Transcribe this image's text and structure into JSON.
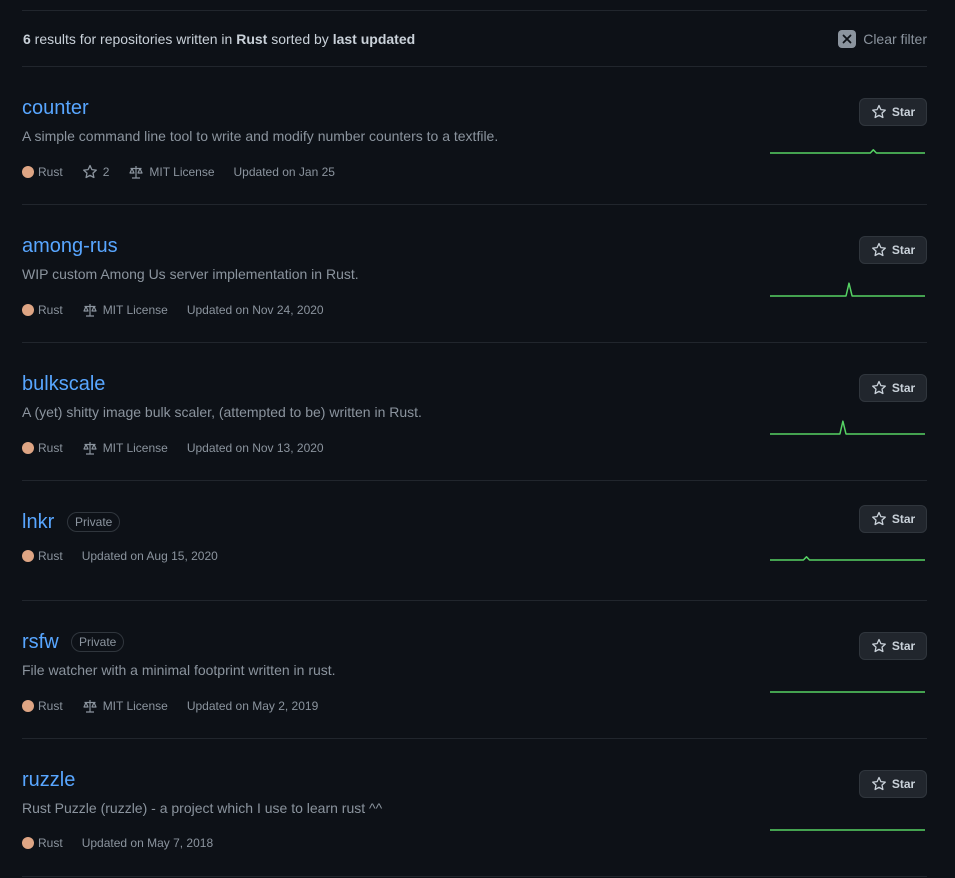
{
  "header": {
    "count": "6",
    "text_a": " results for repositories written in ",
    "language": "Rust",
    "text_b": " sorted by ",
    "sort": "last updated",
    "clear_label": "Clear filter"
  },
  "star_label": "Star",
  "colors": {
    "rust": "#dea584",
    "link": "#58a6ff",
    "spark": "#56d364"
  },
  "repos": [
    {
      "name": "counter",
      "description": "A simple command line tool to write and modify number counters to a textfile.",
      "language": "Rust",
      "stars": "2",
      "license": "MIT License",
      "updated": "Updated on Jan 25",
      "activity": [
        0,
        0,
        0,
        0,
        0,
        0,
        0,
        0,
        0,
        0,
        0,
        0,
        0,
        0,
        0,
        0,
        0,
        0,
        0,
        0,
        0,
        0,
        0,
        0,
        0,
        0,
        0,
        0,
        0,
        0,
        0,
        0,
        0,
        0,
        1,
        0,
        0,
        0,
        0,
        0,
        0,
        0,
        0,
        0,
        0,
        0,
        0,
        0,
        0,
        0,
        0,
        0
      ]
    },
    {
      "name": "among-rus",
      "description": "WIP custom Among Us server implementation in Rust.",
      "language": "Rust",
      "license": "MIT License",
      "updated": "Updated on Nov 24, 2020",
      "activity": [
        0,
        0,
        0,
        0,
        0,
        0,
        0,
        0,
        0,
        0,
        0,
        0,
        0,
        0,
        0,
        0,
        0,
        0,
        0,
        0,
        0,
        0,
        0,
        0,
        0,
        0,
        4,
        0,
        0,
        0,
        0,
        0,
        0,
        0,
        0,
        0,
        0,
        0,
        0,
        0,
        0,
        0,
        0,
        0,
        0,
        0,
        0,
        0,
        0,
        0,
        0,
        0
      ]
    },
    {
      "name": "bulkscale",
      "description": "A (yet) shitty image bulk scaler, (attempted to be) written in Rust.",
      "language": "Rust",
      "license": "MIT License",
      "updated": "Updated on Nov 13, 2020",
      "activity": [
        0,
        0,
        0,
        0,
        0,
        0,
        0,
        0,
        0,
        0,
        0,
        0,
        0,
        0,
        0,
        0,
        0,
        0,
        0,
        0,
        0,
        0,
        0,
        0,
        4,
        0,
        0,
        0,
        0,
        0,
        0,
        0,
        0,
        0,
        0,
        0,
        0,
        0,
        0,
        0,
        0,
        0,
        0,
        0,
        0,
        0,
        0,
        0,
        0,
        0,
        0,
        0
      ]
    },
    {
      "name": "lnkr",
      "badge": "Private",
      "language": "Rust",
      "updated": "Updated on Aug 15, 2020",
      "activity": [
        0,
        0,
        0,
        0,
        0,
        0,
        0,
        0,
        0,
        0,
        0,
        0,
        1,
        0,
        0,
        0,
        0,
        0,
        0,
        0,
        0,
        0,
        0,
        0,
        0,
        0,
        0,
        0,
        0,
        0,
        0,
        0,
        0,
        0,
        0,
        0,
        0,
        0,
        0,
        0,
        0,
        0,
        0,
        0,
        0,
        0,
        0,
        0,
        0,
        0,
        0,
        0
      ]
    },
    {
      "name": "rsfw",
      "badge": "Private",
      "description": "File watcher with a minimal footprint written in rust.",
      "language": "Rust",
      "license": "MIT License",
      "updated": "Updated on May 2, 2019",
      "activity": [
        0,
        0,
        0,
        0,
        0,
        0,
        0,
        0,
        0,
        0,
        0,
        0,
        0,
        0,
        0,
        0,
        0,
        0,
        0,
        0,
        0,
        0,
        0,
        0,
        0,
        0,
        0,
        0,
        0,
        0,
        0,
        0,
        0,
        0,
        0,
        0,
        0,
        0,
        0,
        0,
        0,
        0,
        0,
        0,
        0,
        0,
        0,
        0,
        0,
        0,
        0,
        0
      ]
    },
    {
      "name": "ruzzle",
      "description": "Rust Puzzle (ruzzle) - a project which I use to learn rust ^^",
      "language": "Rust",
      "updated": "Updated on May 7, 2018",
      "activity": [
        0,
        0,
        0,
        0,
        0,
        0,
        0,
        0,
        0,
        0,
        0,
        0,
        0,
        0,
        0,
        0,
        0,
        0,
        0,
        0,
        0,
        0,
        0,
        0,
        0,
        0,
        0,
        0,
        0,
        0,
        0,
        0,
        0,
        0,
        0,
        0,
        0,
        0,
        0,
        0,
        0,
        0,
        0,
        0,
        0,
        0,
        0,
        0,
        0,
        0,
        0,
        0
      ]
    }
  ]
}
